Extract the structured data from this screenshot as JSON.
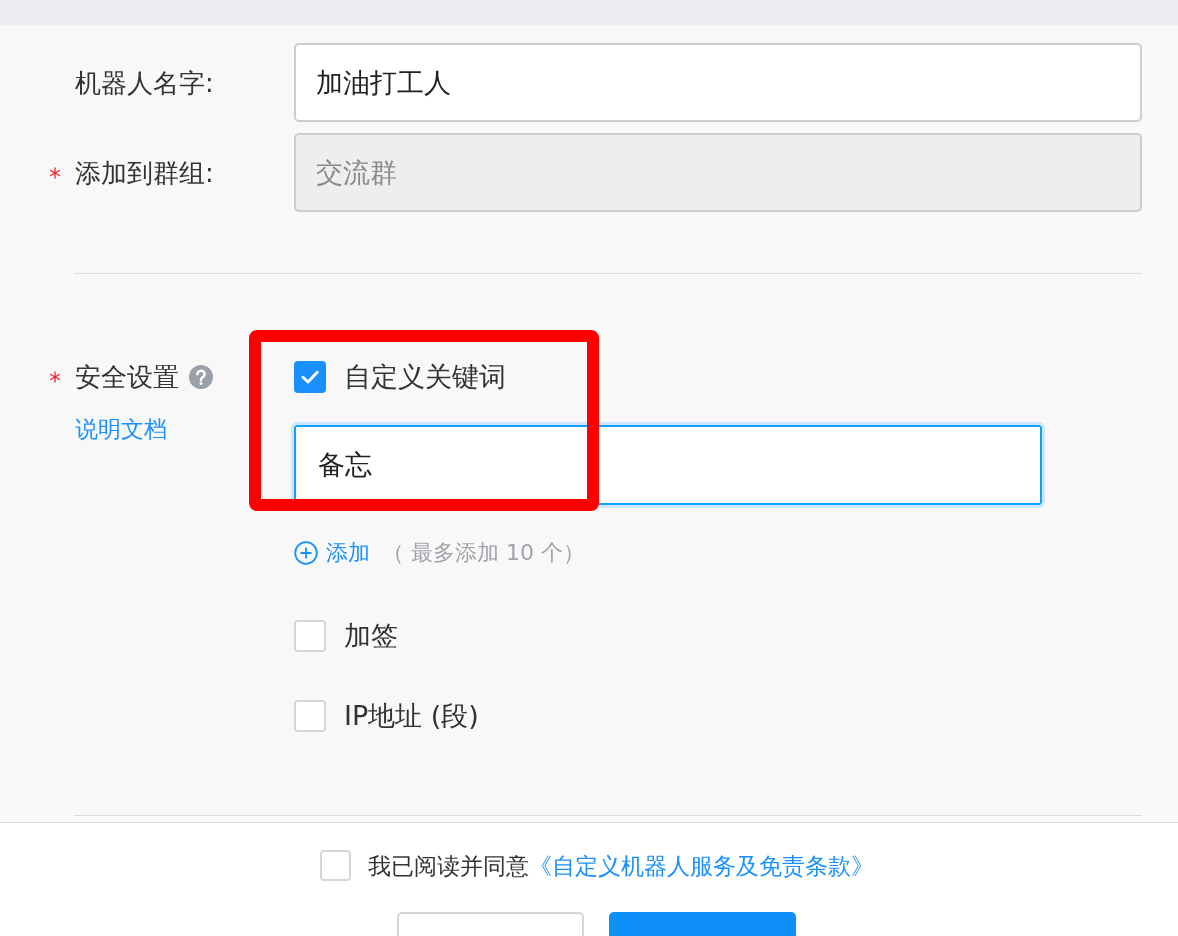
{
  "form": {
    "fields": [
      {
        "label": "机器人名字:",
        "required": false,
        "value": "加油打工人",
        "disabled": false
      },
      {
        "label": "添加到群组:",
        "required": true,
        "value": "交流群",
        "disabled": true
      }
    ]
  },
  "security": {
    "label": "安全设置",
    "required": true,
    "help_link": "说明文档",
    "options": [
      {
        "kind": "keywords",
        "label": "自定义关键词",
        "checked": true,
        "keywords": [
          {
            "value": "备忘",
            "focused": true
          }
        ],
        "add_link": "添加",
        "add_hint": "（ 最多添加 10 个）"
      },
      {
        "kind": "plain",
        "label": "加签",
        "checked": false
      },
      {
        "kind": "plain",
        "label": "IP地址 (段)",
        "checked": false
      }
    ]
  },
  "footer": {
    "agreement": {
      "checked": false,
      "text": "我已阅读并同意",
      "link": "《自定义机器人服务及免责条款》"
    },
    "buttons": [
      {
        "kind": "secondary"
      },
      {
        "kind": "primary"
      }
    ]
  }
}
